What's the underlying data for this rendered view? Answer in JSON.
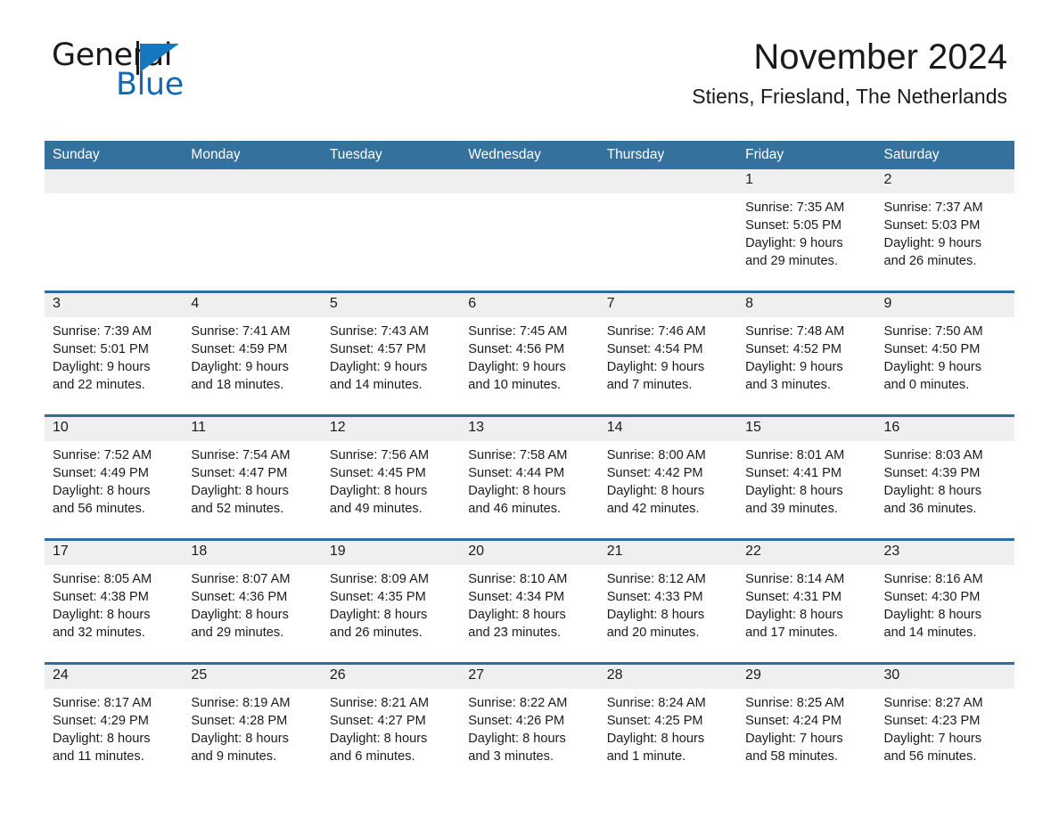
{
  "brand": {
    "name_part1": "General",
    "name_part2": "Blue",
    "flag_color": "#1577be",
    "text_color": "#1668b3"
  },
  "header": {
    "title": "November 2024",
    "subtitle": "Stiens, Friesland, The Netherlands"
  },
  "theme": {
    "header_row_bg": "#35719d",
    "daynum_bg": "#efefef",
    "row_rule": "#2e6da4",
    "text": "#1b1b1b"
  },
  "weekday_headers": [
    "Sunday",
    "Monday",
    "Tuesday",
    "Wednesday",
    "Thursday",
    "Friday",
    "Saturday"
  ],
  "weeks": [
    {
      "days": [
        {
          "num": "",
          "blank": true,
          "l1": "",
          "l2": "",
          "l3": "",
          "l4": ""
        },
        {
          "num": "",
          "blank": true,
          "l1": "",
          "l2": "",
          "l3": "",
          "l4": ""
        },
        {
          "num": "",
          "blank": true,
          "l1": "",
          "l2": "",
          "l3": "",
          "l4": ""
        },
        {
          "num": "",
          "blank": true,
          "l1": "",
          "l2": "",
          "l3": "",
          "l4": ""
        },
        {
          "num": "",
          "blank": true,
          "l1": "",
          "l2": "",
          "l3": "",
          "l4": ""
        },
        {
          "num": "1",
          "blank": false,
          "l1": "Sunrise: 7:35 AM",
          "l2": "Sunset: 5:05 PM",
          "l3": "Daylight: 9 hours",
          "l4": "and 29 minutes."
        },
        {
          "num": "2",
          "blank": false,
          "l1": "Sunrise: 7:37 AM",
          "l2": "Sunset: 5:03 PM",
          "l3": "Daylight: 9 hours",
          "l4": "and 26 minutes."
        }
      ]
    },
    {
      "days": [
        {
          "num": "3",
          "blank": false,
          "l1": "Sunrise: 7:39 AM",
          "l2": "Sunset: 5:01 PM",
          "l3": "Daylight: 9 hours",
          "l4": "and 22 minutes."
        },
        {
          "num": "4",
          "blank": false,
          "l1": "Sunrise: 7:41 AM",
          "l2": "Sunset: 4:59 PM",
          "l3": "Daylight: 9 hours",
          "l4": "and 18 minutes."
        },
        {
          "num": "5",
          "blank": false,
          "l1": "Sunrise: 7:43 AM",
          "l2": "Sunset: 4:57 PM",
          "l3": "Daylight: 9 hours",
          "l4": "and 14 minutes."
        },
        {
          "num": "6",
          "blank": false,
          "l1": "Sunrise: 7:45 AM",
          "l2": "Sunset: 4:56 PM",
          "l3": "Daylight: 9 hours",
          "l4": "and 10 minutes."
        },
        {
          "num": "7",
          "blank": false,
          "l1": "Sunrise: 7:46 AM",
          "l2": "Sunset: 4:54 PM",
          "l3": "Daylight: 9 hours",
          "l4": "and 7 minutes."
        },
        {
          "num": "8",
          "blank": false,
          "l1": "Sunrise: 7:48 AM",
          "l2": "Sunset: 4:52 PM",
          "l3": "Daylight: 9 hours",
          "l4": "and 3 minutes."
        },
        {
          "num": "9",
          "blank": false,
          "l1": "Sunrise: 7:50 AM",
          "l2": "Sunset: 4:50 PM",
          "l3": "Daylight: 9 hours",
          "l4": "and 0 minutes."
        }
      ]
    },
    {
      "days": [
        {
          "num": "10",
          "blank": false,
          "l1": "Sunrise: 7:52 AM",
          "l2": "Sunset: 4:49 PM",
          "l3": "Daylight: 8 hours",
          "l4": "and 56 minutes."
        },
        {
          "num": "11",
          "blank": false,
          "l1": "Sunrise: 7:54 AM",
          "l2": "Sunset: 4:47 PM",
          "l3": "Daylight: 8 hours",
          "l4": "and 52 minutes."
        },
        {
          "num": "12",
          "blank": false,
          "l1": "Sunrise: 7:56 AM",
          "l2": "Sunset: 4:45 PM",
          "l3": "Daylight: 8 hours",
          "l4": "and 49 minutes."
        },
        {
          "num": "13",
          "blank": false,
          "l1": "Sunrise: 7:58 AM",
          "l2": "Sunset: 4:44 PM",
          "l3": "Daylight: 8 hours",
          "l4": "and 46 minutes."
        },
        {
          "num": "14",
          "blank": false,
          "l1": "Sunrise: 8:00 AM",
          "l2": "Sunset: 4:42 PM",
          "l3": "Daylight: 8 hours",
          "l4": "and 42 minutes."
        },
        {
          "num": "15",
          "blank": false,
          "l1": "Sunrise: 8:01 AM",
          "l2": "Sunset: 4:41 PM",
          "l3": "Daylight: 8 hours",
          "l4": "and 39 minutes."
        },
        {
          "num": "16",
          "blank": false,
          "l1": "Sunrise: 8:03 AM",
          "l2": "Sunset: 4:39 PM",
          "l3": "Daylight: 8 hours",
          "l4": "and 36 minutes."
        }
      ]
    },
    {
      "days": [
        {
          "num": "17",
          "blank": false,
          "l1": "Sunrise: 8:05 AM",
          "l2": "Sunset: 4:38 PM",
          "l3": "Daylight: 8 hours",
          "l4": "and 32 minutes."
        },
        {
          "num": "18",
          "blank": false,
          "l1": "Sunrise: 8:07 AM",
          "l2": "Sunset: 4:36 PM",
          "l3": "Daylight: 8 hours",
          "l4": "and 29 minutes."
        },
        {
          "num": "19",
          "blank": false,
          "l1": "Sunrise: 8:09 AM",
          "l2": "Sunset: 4:35 PM",
          "l3": "Daylight: 8 hours",
          "l4": "and 26 minutes."
        },
        {
          "num": "20",
          "blank": false,
          "l1": "Sunrise: 8:10 AM",
          "l2": "Sunset: 4:34 PM",
          "l3": "Daylight: 8 hours",
          "l4": "and 23 minutes."
        },
        {
          "num": "21",
          "blank": false,
          "l1": "Sunrise: 8:12 AM",
          "l2": "Sunset: 4:33 PM",
          "l3": "Daylight: 8 hours",
          "l4": "and 20 minutes."
        },
        {
          "num": "22",
          "blank": false,
          "l1": "Sunrise: 8:14 AM",
          "l2": "Sunset: 4:31 PM",
          "l3": "Daylight: 8 hours",
          "l4": "and 17 minutes."
        },
        {
          "num": "23",
          "blank": false,
          "l1": "Sunrise: 8:16 AM",
          "l2": "Sunset: 4:30 PM",
          "l3": "Daylight: 8 hours",
          "l4": "and 14 minutes."
        }
      ]
    },
    {
      "days": [
        {
          "num": "24",
          "blank": false,
          "l1": "Sunrise: 8:17 AM",
          "l2": "Sunset: 4:29 PM",
          "l3": "Daylight: 8 hours",
          "l4": "and 11 minutes."
        },
        {
          "num": "25",
          "blank": false,
          "l1": "Sunrise: 8:19 AM",
          "l2": "Sunset: 4:28 PM",
          "l3": "Daylight: 8 hours",
          "l4": "and 9 minutes."
        },
        {
          "num": "26",
          "blank": false,
          "l1": "Sunrise: 8:21 AM",
          "l2": "Sunset: 4:27 PM",
          "l3": "Daylight: 8 hours",
          "l4": "and 6 minutes."
        },
        {
          "num": "27",
          "blank": false,
          "l1": "Sunrise: 8:22 AM",
          "l2": "Sunset: 4:26 PM",
          "l3": "Daylight: 8 hours",
          "l4": "and 3 minutes."
        },
        {
          "num": "28",
          "blank": false,
          "l1": "Sunrise: 8:24 AM",
          "l2": "Sunset: 4:25 PM",
          "l3": "Daylight: 8 hours",
          "l4": "and 1 minute."
        },
        {
          "num": "29",
          "blank": false,
          "l1": "Sunrise: 8:25 AM",
          "l2": "Sunset: 4:24 PM",
          "l3": "Daylight: 7 hours",
          "l4": "and 58 minutes."
        },
        {
          "num": "30",
          "blank": false,
          "l1": "Sunrise: 8:27 AM",
          "l2": "Sunset: 4:23 PM",
          "l3": "Daylight: 7 hours",
          "l4": "and 56 minutes."
        }
      ]
    }
  ]
}
